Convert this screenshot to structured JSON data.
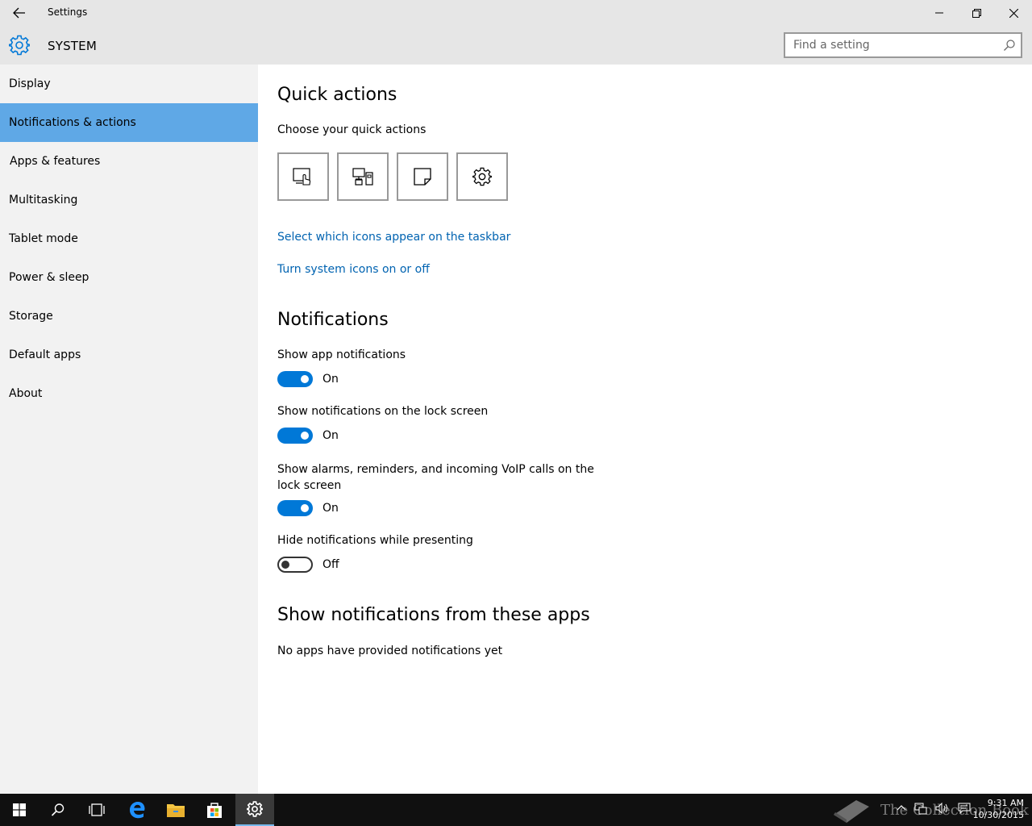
{
  "window": {
    "title": "Settings"
  },
  "header": {
    "section": "SYSTEM",
    "search_placeholder": "Find a setting"
  },
  "sidebar": {
    "items": [
      {
        "label": "Display"
      },
      {
        "label": "Notifications & actions",
        "selected": true
      },
      {
        "label": "Apps & features"
      },
      {
        "label": "Multitasking"
      },
      {
        "label": "Tablet mode"
      },
      {
        "label": "Power & sleep"
      },
      {
        "label": "Storage"
      },
      {
        "label": "Default apps"
      },
      {
        "label": "About"
      }
    ]
  },
  "main": {
    "quick_actions": {
      "heading": "Quick actions",
      "subheading": "Choose your quick actions",
      "tiles": [
        "tablet-mode-icon",
        "connect-icon",
        "note-icon",
        "settings-gear-icon"
      ],
      "link_taskbar_icons": "Select which icons appear on the taskbar",
      "link_system_icons": "Turn system icons on or off"
    },
    "notifications": {
      "heading": "Notifications",
      "settings": [
        {
          "label": "Show app notifications",
          "state": "On",
          "on": true
        },
        {
          "label": "Show notifications on the lock screen",
          "state": "On",
          "on": true
        },
        {
          "label": "Show alarms, reminders, and incoming VoIP calls on the lock screen",
          "state": "On",
          "on": true
        },
        {
          "label": "Hide notifications while presenting",
          "state": "Off",
          "on": false
        }
      ]
    },
    "apps": {
      "heading": "Show notifications from these apps",
      "empty_text": "No apps have provided notifications yet"
    }
  },
  "taskbar": {
    "time": "9:31 AM",
    "date": "10/30/2015",
    "watermark": "The Collection Book"
  },
  "colors": {
    "accent": "#0078d7",
    "sidebar_selected": "#5fa8e6",
    "link": "#0063b1"
  }
}
